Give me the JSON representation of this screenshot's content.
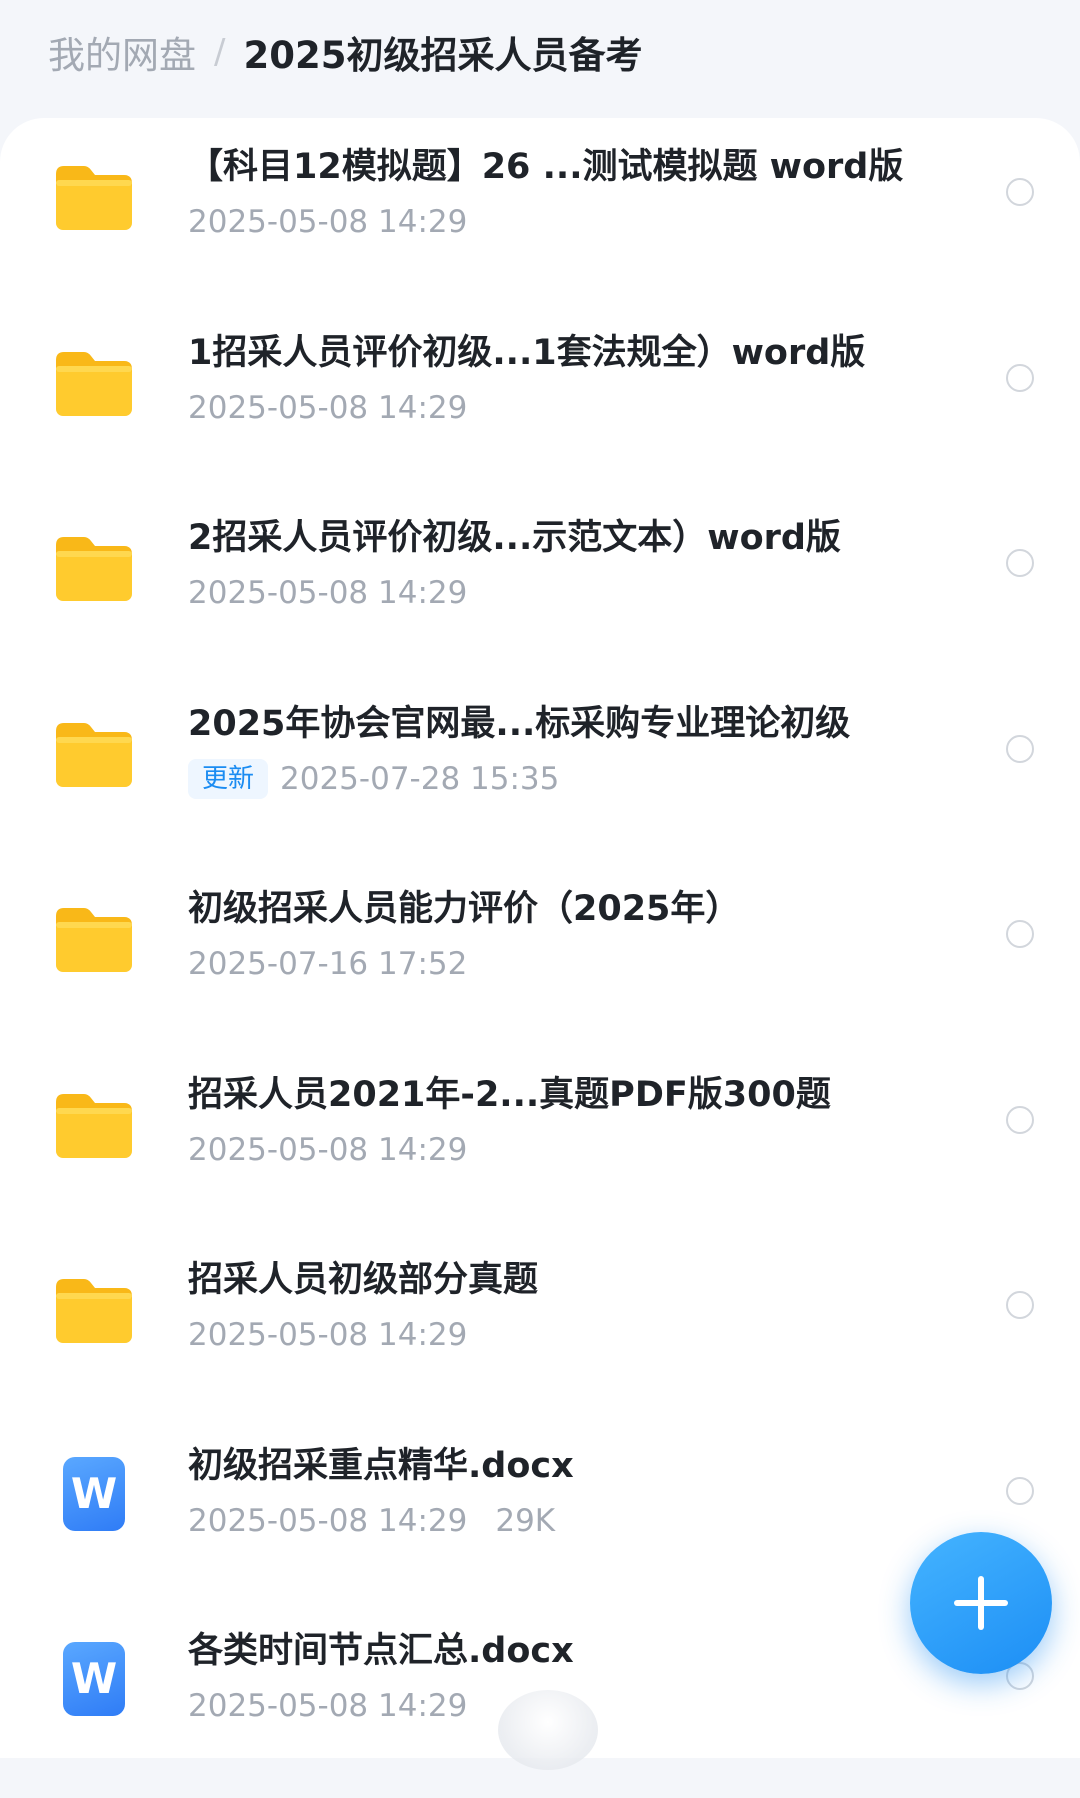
{
  "breadcrumb": {
    "root": "我的网盘",
    "separator": "/",
    "current": "2025初级招采人员备考"
  },
  "files": [
    {
      "type": "folder",
      "icon": "folder-icon",
      "name": "【科目12模拟题】26 ...测试模拟题 word版",
      "date": "2025-05-08 14:29",
      "badge": "",
      "size": ""
    },
    {
      "type": "folder",
      "icon": "folder-icon",
      "name": "1招采人员评价初级...1套法规全）word版",
      "date": "2025-05-08 14:29",
      "badge": "",
      "size": ""
    },
    {
      "type": "folder",
      "icon": "folder-icon",
      "name": "2招采人员评价初级...示范文本）word版",
      "date": "2025-05-08 14:29",
      "badge": "",
      "size": ""
    },
    {
      "type": "folder",
      "icon": "folder-icon",
      "name": "2025年协会官网最...标采购专业理论初级",
      "date": "2025-07-28 15:35",
      "badge": "更新",
      "size": ""
    },
    {
      "type": "folder",
      "icon": "folder-icon",
      "name": "初级招采人员能力评价（2025年）",
      "date": "2025-07-16 17:52",
      "badge": "",
      "size": ""
    },
    {
      "type": "folder",
      "icon": "folder-icon",
      "name": "招采人员2021年-2...真题PDF版300题",
      "date": "2025-05-08 14:29",
      "badge": "",
      "size": ""
    },
    {
      "type": "folder",
      "icon": "folder-icon",
      "name": "招采人员初级部分真题",
      "date": "2025-05-08 14:29",
      "badge": "",
      "size": ""
    },
    {
      "type": "word",
      "icon": "word-doc-icon",
      "icon_letter": "W",
      "name": "初级招采重点精华.docx",
      "date": "2025-05-08 14:29",
      "badge": "",
      "size": "29K"
    },
    {
      "type": "word",
      "icon": "word-doc-icon",
      "icon_letter": "W",
      "name": "各类时间节点汇总.docx",
      "date": "2025-05-08 14:29",
      "badge": "",
      "size": ""
    }
  ],
  "fab": {
    "icon": "plus-icon"
  },
  "colors": {
    "accent": "#1B8CF2",
    "folder": "#FFCB2E",
    "word": "#2F7CF6",
    "text_primary": "#1F2329",
    "text_secondary": "#A3A9B3"
  }
}
